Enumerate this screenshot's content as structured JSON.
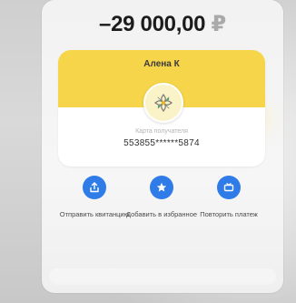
{
  "amount": {
    "value": "–29 000,00",
    "currency": "₽"
  },
  "card": {
    "name": "Алена К",
    "subtitle": "Карта получателя",
    "number": "553855******5874",
    "logo_icon": "flower-logo-icon"
  },
  "actions": [
    {
      "icon": "share-icon",
      "label": "Отправить квитанцию"
    },
    {
      "icon": "star-icon",
      "label": "Добавить в избранное"
    },
    {
      "icon": "repeat-icon",
      "label": "Повторить платеж"
    }
  ],
  "colors": {
    "accent": "#2f7ce8",
    "card_header": "#f6d54a",
    "currency": "#a9a9a9"
  }
}
